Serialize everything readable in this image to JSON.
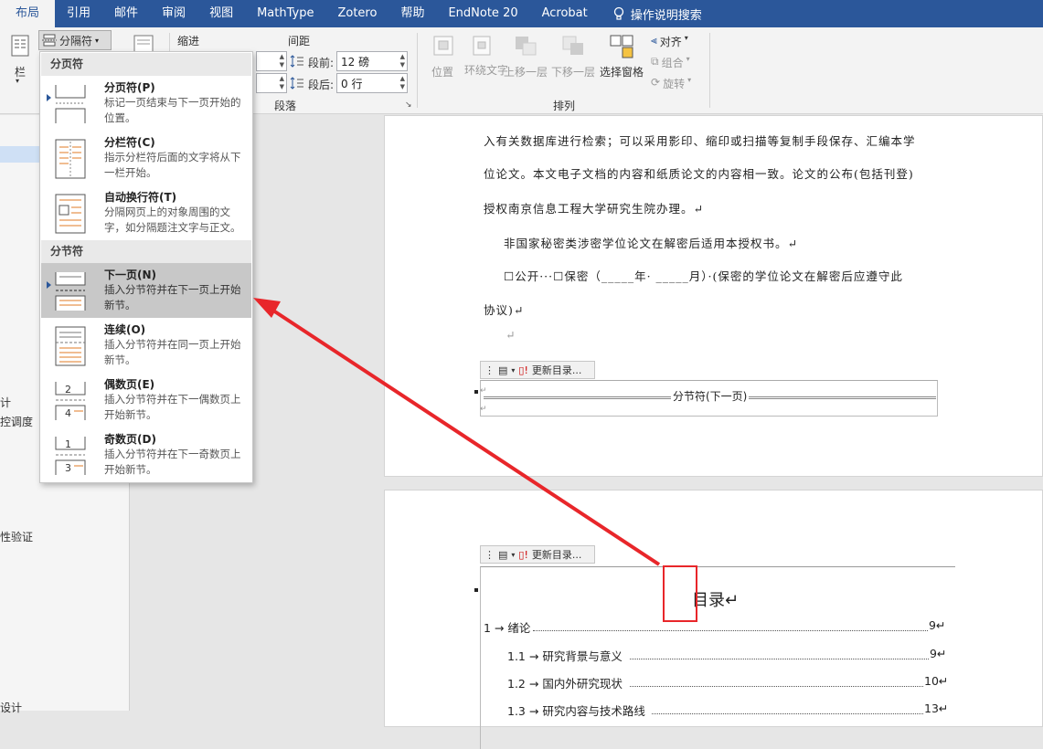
{
  "menubar": {
    "tabs": [
      "布局",
      "引用",
      "邮件",
      "审阅",
      "视图",
      "MathType",
      "Zotero",
      "帮助",
      "EndNote 20",
      "Acrobat"
    ],
    "search_label": "操作说明搜索"
  },
  "ribbon": {
    "breaks_button": "分隔符",
    "columns_label": "栏",
    "indent_label": "缩进",
    "spacing_label": "间距",
    "before_label": "段前:",
    "before_value": "12 磅",
    "after_label": "段后:",
    "after_value": "0 行",
    "paragraph_group": "段落",
    "arrange_group": "排列",
    "position": "位置",
    "wrap_text": "环绕文字",
    "bring_forward": "上移一层",
    "send_backward": "下移一层",
    "selection_pane": "选择窗格",
    "align": "对齐",
    "group": "组合",
    "rotate": "旋转"
  },
  "leftpane": {
    "items": [
      "计",
      "控调度",
      "性验证",
      "设计"
    ]
  },
  "dropdown": {
    "page_breaks_header": "分页符",
    "section_breaks_header": "分节符",
    "items": [
      {
        "title": "分页符(P)",
        "desc": "标记一页结束与下一页开始的位置。"
      },
      {
        "title": "分栏符(C)",
        "desc": "指示分栏符后面的文字将从下一栏开始。"
      },
      {
        "title": "自动换行符(T)",
        "desc": "分隔网页上的对象周围的文字，如分隔题注文字与正文。"
      },
      {
        "title": "下一页(N)",
        "desc": "插入分节符并在下一页上开始新节。"
      },
      {
        "title": "连续(O)",
        "desc": "插入分节符并在同一页上开始新节。"
      },
      {
        "title": "偶数页(E)",
        "desc": "插入分节符并在下一偶数页上开始新节。"
      },
      {
        "title": "奇数页(D)",
        "desc": "插入分节符并在下一奇数页上开始新节。"
      }
    ]
  },
  "document": {
    "page1_lines": [
      "入有关数据库进行检索；可以采用影印、缩印或扫描等复制手段保存、汇编本学",
      "位论文。本文电子文档的内容和纸质论文的内容相一致。论文的公布(包括刊登)",
      "授权南京信息工程大学研究生院办理。↵",
      "非国家秘密类涉密学位论文在解密后适用本授权书。↵",
      "☐公开···☐保密（_____年· _____月）·(保密的学位论文在解密后应遵守此",
      "协议)↵",
      "↵"
    ],
    "update_toc": "更新目录...",
    "section_break_label": "分节符(下一页)",
    "toc_title": "目录↵",
    "toc": [
      {
        "num": "1",
        "title": "绪论",
        "page": "9↵"
      },
      {
        "num": "1.1",
        "title": "研究背景与意义",
        "page": "9↵"
      },
      {
        "num": "1.2",
        "title": "国内外研究现状",
        "page": "10↵"
      },
      {
        "num": "1.3",
        "title": "研究内容与技术路线",
        "page": "13↵"
      }
    ]
  },
  "colors": {
    "menubar_bg": "#2b579a",
    "arrow": "#e8262a",
    "highlight_box": "#e8262a"
  }
}
